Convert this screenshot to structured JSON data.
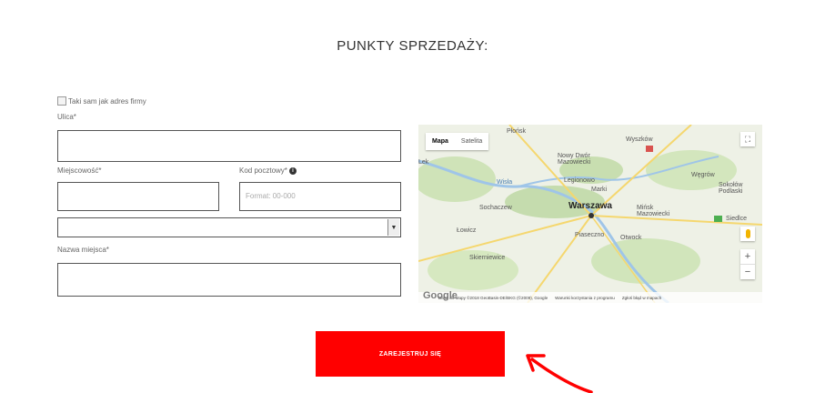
{
  "heading": "PUNKTY SPRZEDAŻY:",
  "form": {
    "same_address_label": "Taki sam jak adres firmy",
    "street_label": "Ulica*",
    "city_label": "Miejscowość*",
    "postal_label": "Kod pocztowy*",
    "postal_placeholder": "Format: 00-000",
    "place_name_label": "Nazwa miejsca*",
    "select_value": ""
  },
  "map": {
    "type_map": "Mapa",
    "type_satellite": "Satelita",
    "fullscreen_glyph": "⛶",
    "zoom_in": "+",
    "zoom_out": "−",
    "places": {
      "plonsk": "Płońsk",
      "wyszkow": "Wyszków",
      "nowy_dwor": "Nowy Dwór\nMazowiecki",
      "legionowo": "Legionowo",
      "marki": "Marki",
      "sochaczew": "Sochaczew",
      "warszawa": "Warszawa",
      "minsk": "Mińsk\nMazowiecki",
      "wegrow": "Węgrów",
      "sokolow": "Sokołów\nPodlaski",
      "siedlce": "Siedlce",
      "lowicz": "Łowicz",
      "piaseczno": "Piaseczno",
      "otwock": "Otwock",
      "skierniewice": "Skierniewice",
      "wisla": "Wisła",
      "lek": "Lek"
    },
    "google": "Google",
    "footer_data": "Dane do Mapy ©2018 GeoBasis-DE/BKG (©2009), Google",
    "footer_terms": "Warunki korzystania z programu",
    "footer_report": "Zgłoś błąd w mapach",
    "colors": {
      "forest": "#c9dfb2",
      "river": "#9fc5e8",
      "road": "#f5d76e"
    }
  },
  "submit_label": "ZAREJESTRUJ SIĘ",
  "colors": {
    "accent": "#ff0000"
  }
}
